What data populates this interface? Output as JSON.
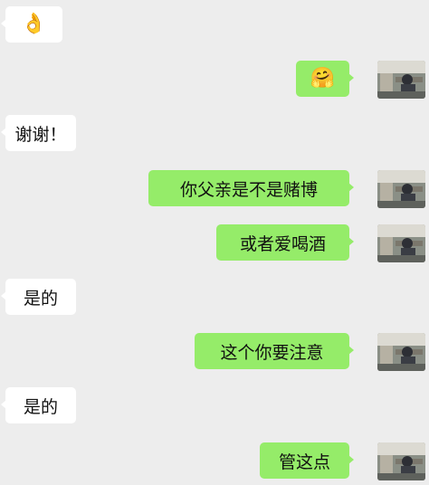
{
  "colors": {
    "background": "#ededed",
    "incoming_bubble": "#ffffff",
    "outgoing_bubble": "#95ec69",
    "text": "#111111"
  },
  "messages": [
    {
      "side": "in",
      "type": "emoji",
      "icon": "ok-hand-emoji-icon",
      "text": "👌"
    },
    {
      "side": "out",
      "type": "emoji",
      "icon": "hug-emoji-icon",
      "text": "🤗"
    },
    {
      "side": "in",
      "type": "text",
      "text": "谢谢！"
    },
    {
      "side": "out",
      "type": "text",
      "text": "你父亲是不是赌博"
    },
    {
      "side": "out",
      "type": "text",
      "text": "或者爱喝酒"
    },
    {
      "side": "in",
      "type": "text",
      "text": "是的"
    },
    {
      "side": "out",
      "type": "text",
      "text": "这个你要注意"
    },
    {
      "side": "in",
      "type": "text",
      "text": "是的"
    },
    {
      "side": "out",
      "type": "text",
      "text": "管这点"
    }
  ]
}
